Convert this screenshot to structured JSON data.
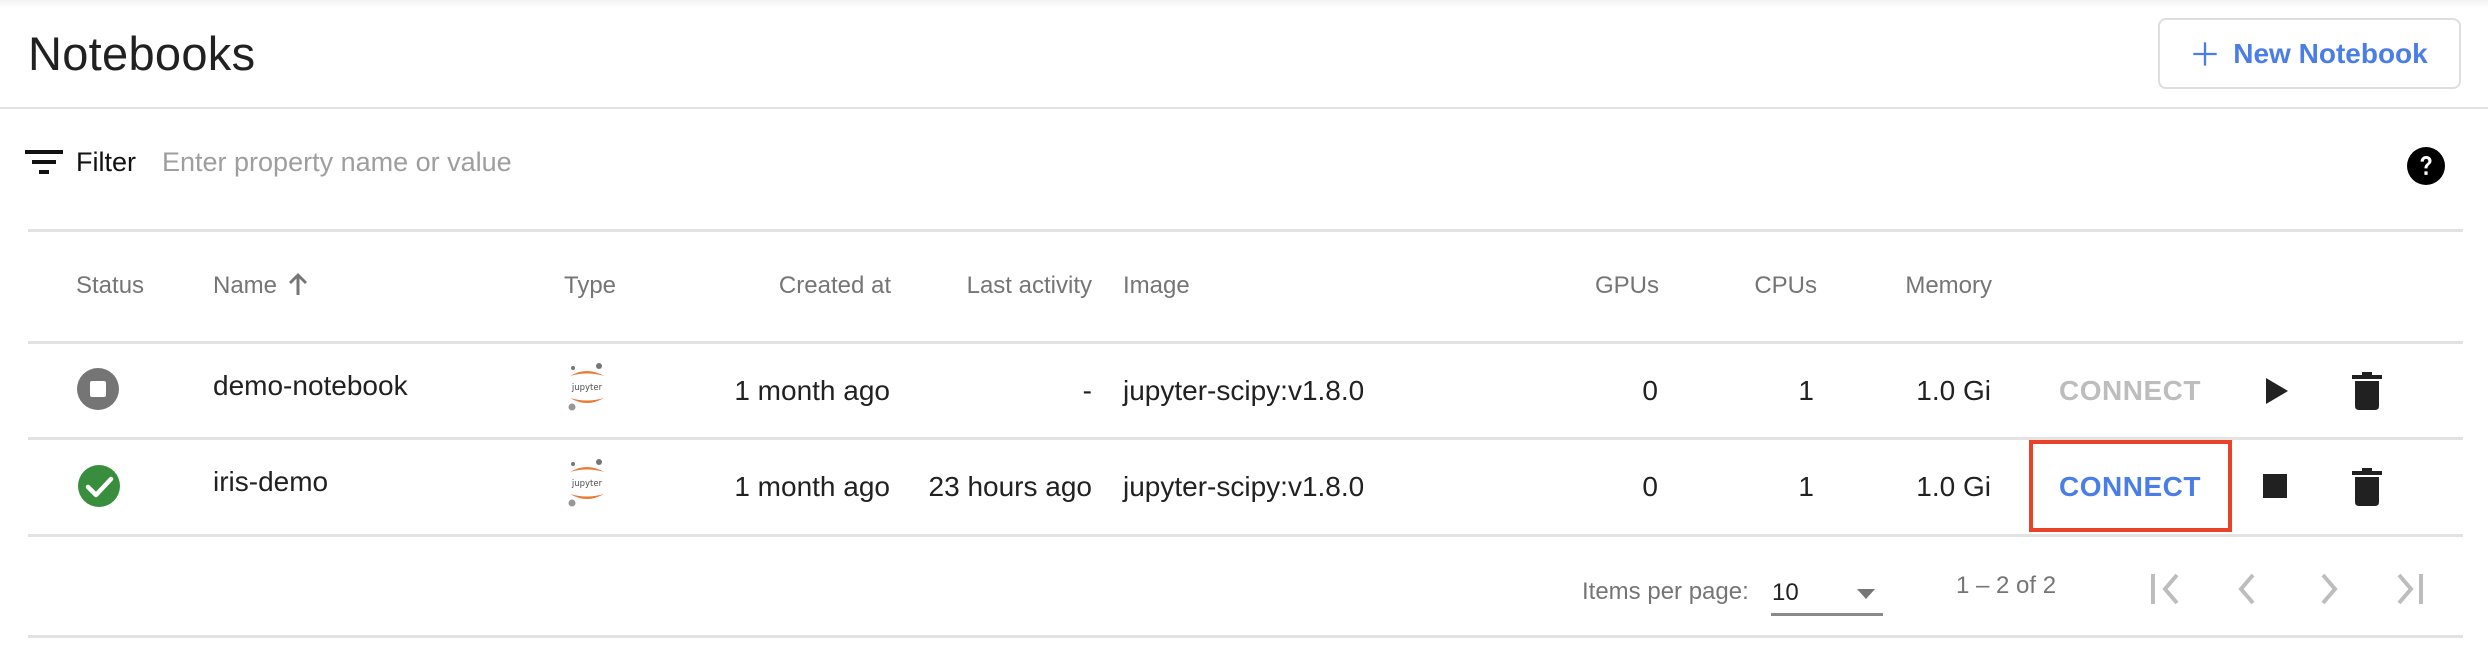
{
  "header": {
    "title": "Notebooks",
    "new_button": {
      "label": "New Notebook",
      "icon": "plus-icon"
    }
  },
  "filter": {
    "icon": "filter-icon",
    "label": "Filter",
    "placeholder": "Enter property name or value",
    "value": "",
    "help_icon": "help-icon"
  },
  "table": {
    "columns": [
      {
        "key": "status",
        "label": "Status"
      },
      {
        "key": "name",
        "label": "Name",
        "sort": "ascending",
        "sort_icon": "arrow-up-icon"
      },
      {
        "key": "type",
        "label": "Type"
      },
      {
        "key": "created",
        "label": "Created at"
      },
      {
        "key": "last_activity",
        "label": "Last activity"
      },
      {
        "key": "image",
        "label": "Image"
      },
      {
        "key": "gpus",
        "label": "GPUs"
      },
      {
        "key": "cpus",
        "label": "CPUs"
      },
      {
        "key": "memory",
        "label": "Memory"
      }
    ],
    "rows": [
      {
        "status": "stopped",
        "status_icon": "stop-circle-icon",
        "status_color": "#757575",
        "name": "demo-notebook",
        "type": "jupyter",
        "type_icon": "jupyter-logo-icon",
        "created": "1 month ago",
        "last_activity": "-",
        "image": "jupyter-scipy:v1.8.0",
        "gpus": "0",
        "cpus": "1",
        "memory": "1.0 Gi",
        "connect_label": "CONNECT",
        "connect_enabled": false,
        "action_icon": "play-icon",
        "delete_icon": "trash-icon"
      },
      {
        "status": "running",
        "status_icon": "check-circle-icon",
        "status_color": "#388e3c",
        "name": "iris-demo",
        "type": "jupyter",
        "type_icon": "jupyter-logo-icon",
        "created": "1 month ago",
        "last_activity": "23 hours ago",
        "image": "jupyter-scipy:v1.8.0",
        "gpus": "0",
        "cpus": "1",
        "memory": "1.0 Gi",
        "connect_label": "CONNECT",
        "connect_enabled": true,
        "action_icon": "stop-icon",
        "delete_icon": "trash-icon"
      }
    ]
  },
  "paginator": {
    "items_per_page_label": "Items per page:",
    "items_per_page": "10",
    "range_label": "1 – 2 of 2",
    "buttons": [
      "first-page-icon",
      "previous-page-icon",
      "next-page-icon",
      "last-page-icon"
    ]
  },
  "colors": {
    "accent": "#4a7de8",
    "highlight": "#e8432a",
    "running": "#388e3c",
    "stopped": "#757575",
    "jupyter_orange": "#e97b35"
  }
}
